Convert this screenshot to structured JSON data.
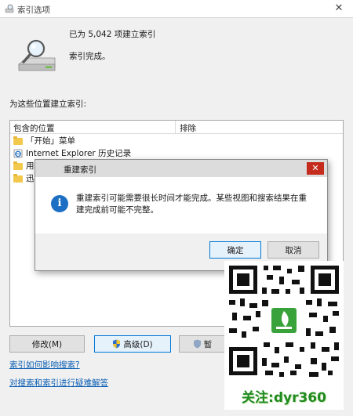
{
  "window": {
    "title": "索引选项"
  },
  "status": {
    "count_text": "已为 5,042 项建立索引",
    "done_text": "索引完成。"
  },
  "locations": {
    "label": "为这些位置建立索引:",
    "columns": [
      "包含的位置",
      "排除"
    ],
    "rows": [
      {
        "label": "「开始」菜单",
        "icon": "folder-icon"
      },
      {
        "label": "Internet Explorer 历史记录",
        "icon": "ie-icon"
      },
      {
        "label": "用",
        "icon": "folder-icon"
      },
      {
        "label": "迅",
        "icon": "folder-icon"
      }
    ]
  },
  "buttons": {
    "modify": "修改(M)",
    "advanced": "高级(D)",
    "pause": "暂"
  },
  "links": {
    "how_index": "索引如何影响搜索?",
    "troubleshoot": "对搜索和索引进行疑难解答"
  },
  "dialog": {
    "title": "重建索引",
    "message": "重建索引可能需要很长时间才能完成。某些视图和搜索结果在重建完成前可能不完整。",
    "ok": "确定",
    "cancel": "取消"
  },
  "watermark": {
    "caption": "关注:dyr360"
  },
  "colors": {
    "accent": "#0078d7",
    "info": "#1d6fc4",
    "close": "#c42b1c",
    "watermark_text": "#1f8a1f"
  }
}
